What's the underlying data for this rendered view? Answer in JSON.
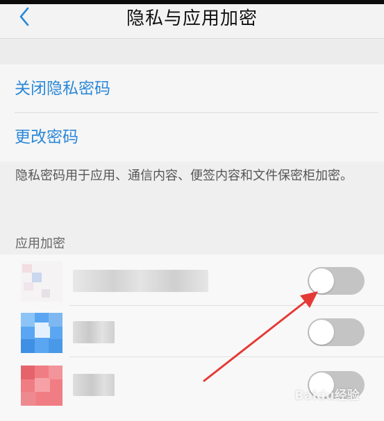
{
  "header": {
    "title": "隐私与应用加密",
    "back_icon": "chevron-left-icon"
  },
  "settings": {
    "items": [
      {
        "label": "关闭隐私密码"
      },
      {
        "label": "更改密码"
      }
    ],
    "description": "隐私密码用于应用、通信内容、便签内容和文件保密柜加密。"
  },
  "app_encryption": {
    "section_label": "应用加密",
    "apps": [
      {
        "name_blurred": true,
        "enabled": false
      },
      {
        "name_blurred": true,
        "enabled": false
      },
      {
        "name_blurred": true,
        "enabled": false
      }
    ]
  },
  "colors": {
    "accent_blue": "#2a88d8",
    "toggle_off": "#c4c4c4",
    "annotation_red": "#e53935"
  },
  "watermark": "Baidu经验"
}
